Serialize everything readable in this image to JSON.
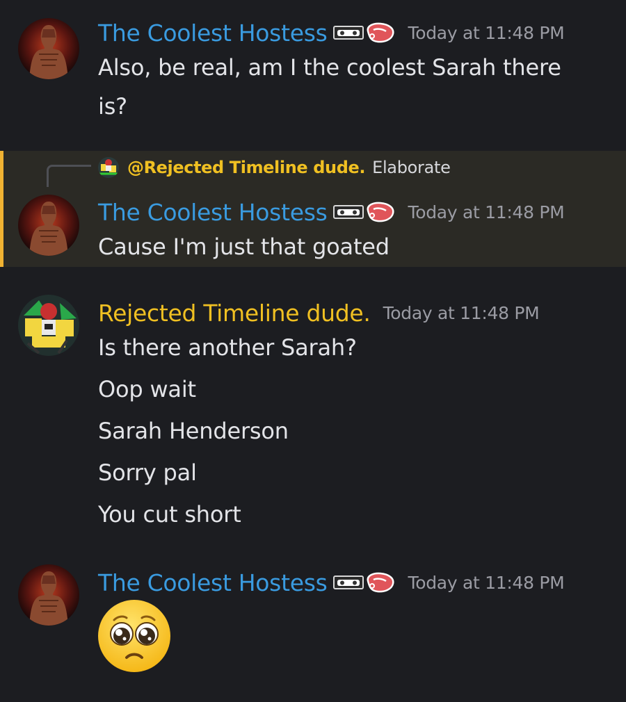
{
  "users": {
    "hostess": "The Coolest Hostess",
    "rejected": "Rejected Timeline dude."
  },
  "badges": [
    "vhs-tape-icon",
    "meat-steak-icon"
  ],
  "colors": {
    "hostess_name": "#3a9be0",
    "rejected_name": "#f0c022",
    "reply_accent": "#f0b232",
    "background": "#1c1d21"
  },
  "messages": [
    {
      "author": "The Coolest Hostess",
      "timestamp": "Today at 11:48 PM",
      "lines": [
        "Also, be real, am I the coolest Sarah there",
        "is?"
      ]
    },
    {
      "reply_to": {
        "mention": "@Rejected Timeline dude.",
        "text": "Elaborate"
      },
      "author": "The Coolest Hostess",
      "timestamp": "Today at 11:48 PM",
      "lines": [
        "Cause I'm just that goated"
      ]
    },
    {
      "author": "Rejected Timeline dude.",
      "timestamp": "Today at 11:48 PM",
      "lines": [
        "Is there another Sarah?",
        "Oop wait",
        "Sarah Henderson",
        "Sorry pal",
        "You cut short"
      ]
    },
    {
      "author": "The Coolest Hostess",
      "timestamp": "Today at 11:48 PM",
      "emoji": "pleading-face-emoji"
    }
  ]
}
